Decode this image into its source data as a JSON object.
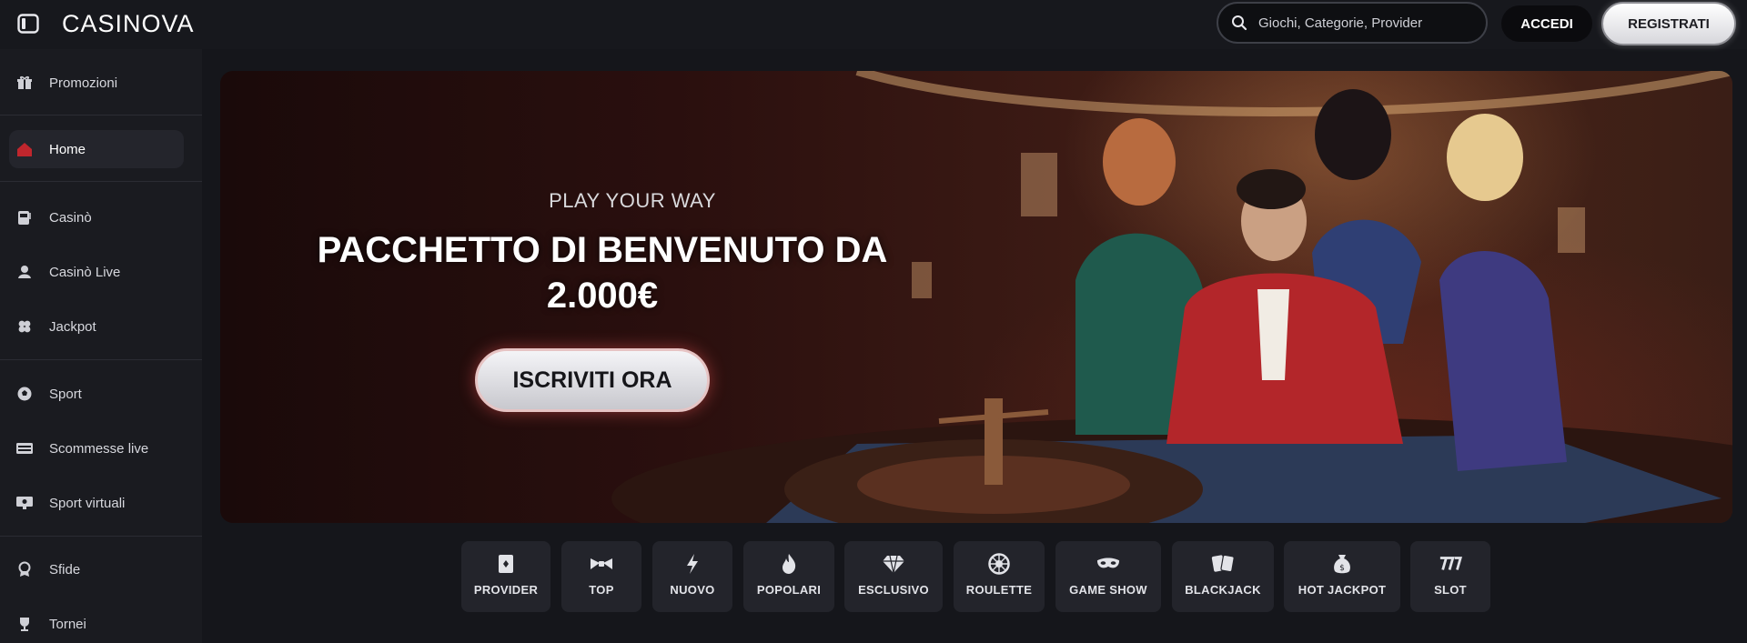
{
  "header": {
    "brand": "CASINOVA",
    "search_placeholder": "Giochi, Categorie, Provider",
    "login_label": "ACCEDI",
    "register_label": "REGISTRATI"
  },
  "sidebar": {
    "items": [
      {
        "label": "Promozioni",
        "icon": "gift-icon"
      },
      {
        "label": "Home",
        "icon": "home-icon",
        "active": true
      },
      {
        "label": "Casinò",
        "icon": "slot-machine-icon"
      },
      {
        "label": "Casinò Live",
        "icon": "live-dealer-icon"
      },
      {
        "label": "Jackpot",
        "icon": "clover-icon"
      },
      {
        "label": "Sport",
        "icon": "soccer-ball-icon"
      },
      {
        "label": "Scommesse live",
        "icon": "scoreboard-icon"
      },
      {
        "label": "Sport virtuali",
        "icon": "virtual-sport-icon"
      },
      {
        "label": "Sfide",
        "icon": "badge-icon"
      },
      {
        "label": "Tornei",
        "icon": "trophy-icon"
      }
    ]
  },
  "hero": {
    "subtitle": "PLAY YOUR WAY",
    "title_line1": "PACCHETTO DI BENVENUTO DA",
    "title_line2": "2.000€",
    "cta_label": "ISCRIVITI ORA"
  },
  "categories": [
    {
      "label": "PROVIDER",
      "icon": "provider-icon"
    },
    {
      "label": "TOP",
      "icon": "bowtie-icon"
    },
    {
      "label": "NUOVO",
      "icon": "lightning-icon"
    },
    {
      "label": "POPOLARI",
      "icon": "flame-icon"
    },
    {
      "label": "ESCLUSIVO",
      "icon": "diamond-icon"
    },
    {
      "label": "ROULETTE",
      "icon": "roulette-icon"
    },
    {
      "label": "GAME SHOW",
      "icon": "mask-icon"
    },
    {
      "label": "BLACKJACK",
      "icon": "cards-icon"
    },
    {
      "label": "HOT JACKPOT",
      "icon": "money-bag-icon"
    },
    {
      "label": "SLOT",
      "icon": "seven-icon"
    }
  ],
  "colors": {
    "background": "#15161b",
    "sidebar": "#1a1b20",
    "accent_red": "#c0262d"
  }
}
